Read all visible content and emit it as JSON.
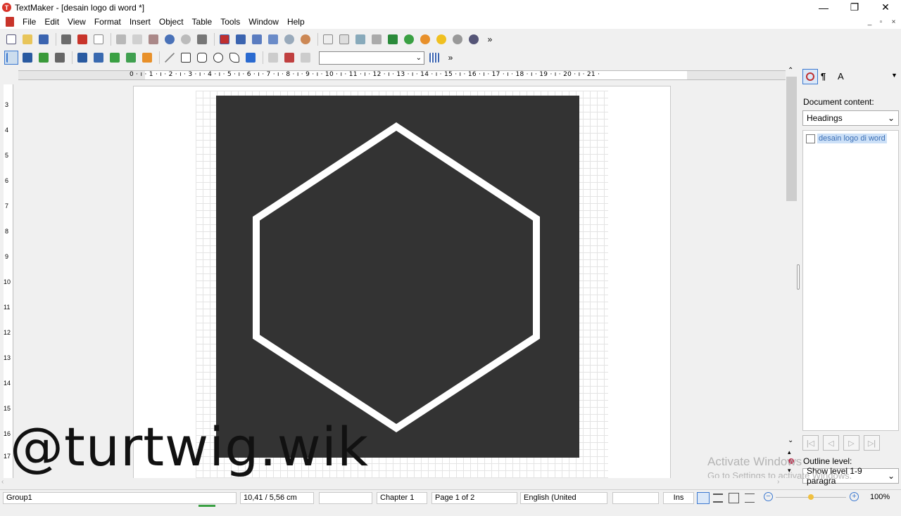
{
  "window": {
    "title": "TextMaker - [desain logo di word *]",
    "minimize": "—",
    "restore": "❐",
    "close": "✕"
  },
  "menu": {
    "items": [
      "File",
      "Edit",
      "View",
      "Format",
      "Insert",
      "Object",
      "Table",
      "Tools",
      "Window",
      "Help"
    ]
  },
  "toolbar": {
    "more": "»",
    "style_dropdown_value": ""
  },
  "ruler": {
    "horizontal_marks": "0 · ı · 1 · ı · 2 · ı · 3 · ı · 4 · ı · 5 · ı · 6 · ı · 7 · ı · 8 · ı · 9 · ı · 10 · ı · 11 · ı · 12 · ı · 13 · ı · 14 · ı · 15 · ı · 16 · ı · 17 · ı · 18 · ı · 19 · ı · 20 · ı · 21 ·",
    "vertical_marks": [
      "3",
      "4",
      "5",
      "6",
      "7",
      "8",
      "9",
      "10",
      "11",
      "12",
      "13",
      "14",
      "15",
      "16",
      "17"
    ]
  },
  "document": {
    "watermark": "@turtwig.wik"
  },
  "side_panel": {
    "document_content_label": "Document content:",
    "content_dropdown": "Headings",
    "outline_items": [
      "desain logo di word"
    ],
    "outline_level_label": "Outline level:",
    "outline_level_dropdown": "Show level 1-9 paragra"
  },
  "os_overlay": {
    "activate_title": "Activate Windows",
    "activate_sub": "Go to Settings to activate Windows."
  },
  "statusbar": {
    "object": "Group1",
    "position": "10,41 / 5,56 cm",
    "blank1": "",
    "chapter": "Chapter 1",
    "page": "Page 1 of 2",
    "language": "English (United",
    "blank2": "",
    "mode": "Ins",
    "zoom": "100%"
  },
  "colors": {
    "accent": "#d9352b",
    "shape_fill": "#333333",
    "shape_stroke": "#ffffff"
  }
}
